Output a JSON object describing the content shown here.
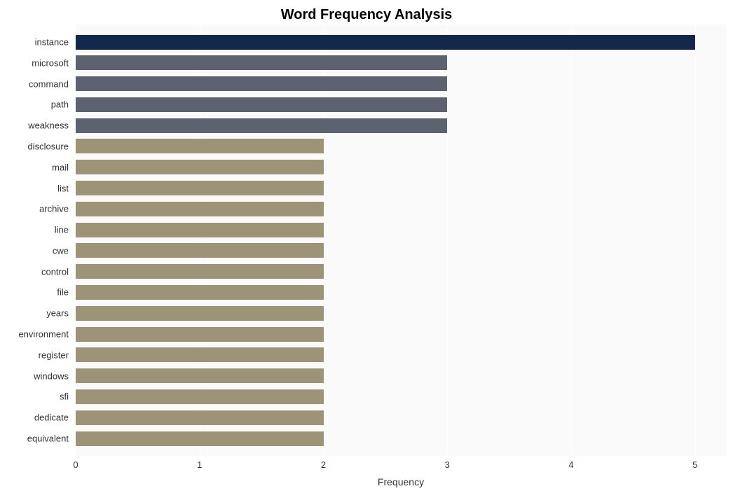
{
  "chart_data": {
    "type": "bar",
    "orientation": "horizontal",
    "title": "Word Frequency Analysis",
    "xlabel": "Frequency",
    "ylabel": "",
    "xlim": [
      0,
      5.25
    ],
    "x_ticks": [
      0,
      1,
      2,
      3,
      4,
      5
    ],
    "categories": [
      "instance",
      "microsoft",
      "command",
      "path",
      "weakness",
      "disclosure",
      "mail",
      "list",
      "archive",
      "line",
      "cwe",
      "control",
      "file",
      "years",
      "environment",
      "register",
      "windows",
      "sfi",
      "dedicate",
      "equivalent"
    ],
    "values": [
      5,
      3,
      3,
      3,
      3,
      2,
      2,
      2,
      2,
      2,
      2,
      2,
      2,
      2,
      2,
      2,
      2,
      2,
      2,
      2
    ],
    "colors": {
      "tier1": "#12294b",
      "tier2": "#5c626f",
      "tier3": "#9d9477"
    }
  }
}
